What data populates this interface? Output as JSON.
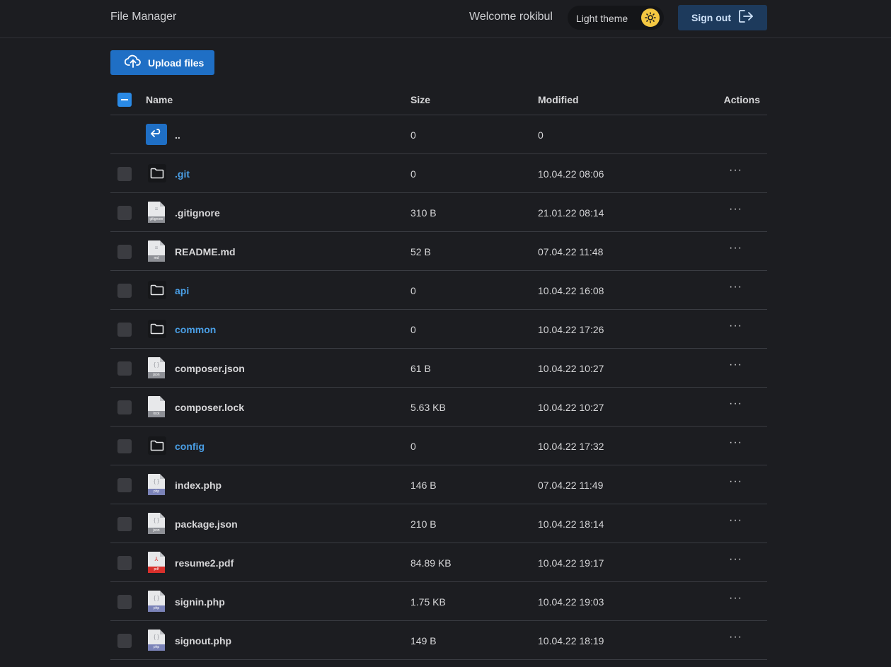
{
  "header": {
    "app_title": "File Manager",
    "welcome": "Welcome rokibul",
    "theme_label": "Light theme",
    "signout_label": "Sign out"
  },
  "toolbar": {
    "upload_label": "Upload files"
  },
  "table": {
    "columns": {
      "name": "Name",
      "size": "Size",
      "modified": "Modified",
      "actions": "Actions"
    },
    "parent_row": {
      "name": "..",
      "size": "0",
      "modified": "0"
    },
    "rows": [
      {
        "name": ".git",
        "type": "folder",
        "size": "0",
        "modified": "10.04.22 08:06",
        "actions": "···"
      },
      {
        "name": ".gitignore",
        "type": "file",
        "ext": "gitignore",
        "size": "310 B",
        "modified": "21.01.22 08:14",
        "actions": "···"
      },
      {
        "name": "README.md",
        "type": "file",
        "ext": "md",
        "size": "52 B",
        "modified": "07.04.22 11:48",
        "actions": "···"
      },
      {
        "name": "api",
        "type": "folder",
        "size": "0",
        "modified": "10.04.22 16:08",
        "actions": "···"
      },
      {
        "name": "common",
        "type": "folder",
        "size": "0",
        "modified": "10.04.22 17:26",
        "actions": "···"
      },
      {
        "name": "composer.json",
        "type": "file",
        "ext": "json",
        "size": "61 B",
        "modified": "10.04.22 10:27",
        "actions": "···"
      },
      {
        "name": "composer.lock",
        "type": "file",
        "ext": "lock",
        "size": "5.63 KB",
        "modified": "10.04.22 10:27",
        "actions": "···"
      },
      {
        "name": "config",
        "type": "folder",
        "size": "0",
        "modified": "10.04.22 17:32",
        "actions": "···"
      },
      {
        "name": "index.php",
        "type": "file",
        "ext": "php",
        "size": "146 B",
        "modified": "07.04.22 11:49",
        "actions": "···"
      },
      {
        "name": "package.json",
        "type": "file",
        "ext": "json",
        "size": "210 B",
        "modified": "10.04.22 18:14",
        "actions": "···"
      },
      {
        "name": "resume2.pdf",
        "type": "file",
        "ext": "pdf",
        "size": "84.89 KB",
        "modified": "10.04.22 19:17",
        "actions": "···"
      },
      {
        "name": "signin.php",
        "type": "file",
        "ext": "php",
        "size": "1.75 KB",
        "modified": "10.04.22 19:03",
        "actions": "···"
      },
      {
        "name": "signout.php",
        "type": "file",
        "ext": "php",
        "size": "149 B",
        "modified": "10.04.22 18:19",
        "actions": "···"
      }
    ]
  },
  "colors": {
    "background": "#1c1d21",
    "accent_blue": "#1f6fc5",
    "link_blue": "#4a9fe6",
    "signout_bg": "#1d3a5c",
    "sun_yellow": "#f5c842",
    "php_band": "#7b83b8",
    "pdf_band": "#d9302c",
    "generic_band": "#8e9096"
  },
  "icons": {
    "upload": "cloud-upload-icon",
    "theme": "sun-icon",
    "signout": "sign-out-icon",
    "parent": "return-arrow-icon",
    "folder": "folder-icon",
    "file": "file-icon",
    "actions": "more-horizontal-icon"
  }
}
